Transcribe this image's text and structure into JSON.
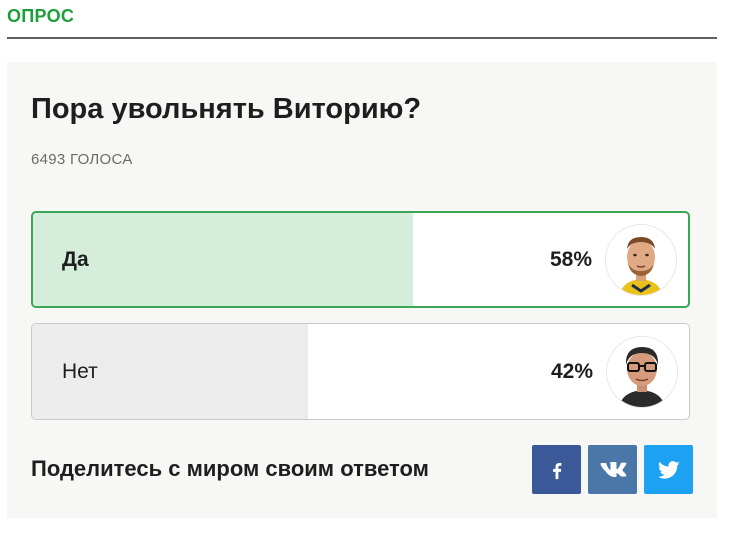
{
  "section": {
    "label": "ОПРОС"
  },
  "poll": {
    "question": "Пора увольнять Виторию?",
    "votes_text": "6493 ГОЛОСА",
    "options": [
      {
        "label": "Да",
        "percent_text": "58%",
        "percent": 58,
        "selected": true,
        "avatar_icon": "player-portrait"
      },
      {
        "label": "Нет",
        "percent_text": "42%",
        "percent": 42,
        "selected": false,
        "avatar_icon": "coach-portrait"
      }
    ]
  },
  "share": {
    "text": "Поделитесь с миром своим ответом",
    "buttons": [
      {
        "network": "facebook",
        "icon": "facebook-icon",
        "color": "#3b5998"
      },
      {
        "network": "vk",
        "icon": "vk-icon",
        "color": "#4a76a8"
      },
      {
        "network": "twitter",
        "icon": "twitter-icon",
        "color": "#1da1f2"
      }
    ]
  },
  "colors": {
    "accent_green": "#1ba03a",
    "selected_border": "#3aa756",
    "selected_fill": "#d5eedb",
    "unselected_fill": "#ececec"
  }
}
